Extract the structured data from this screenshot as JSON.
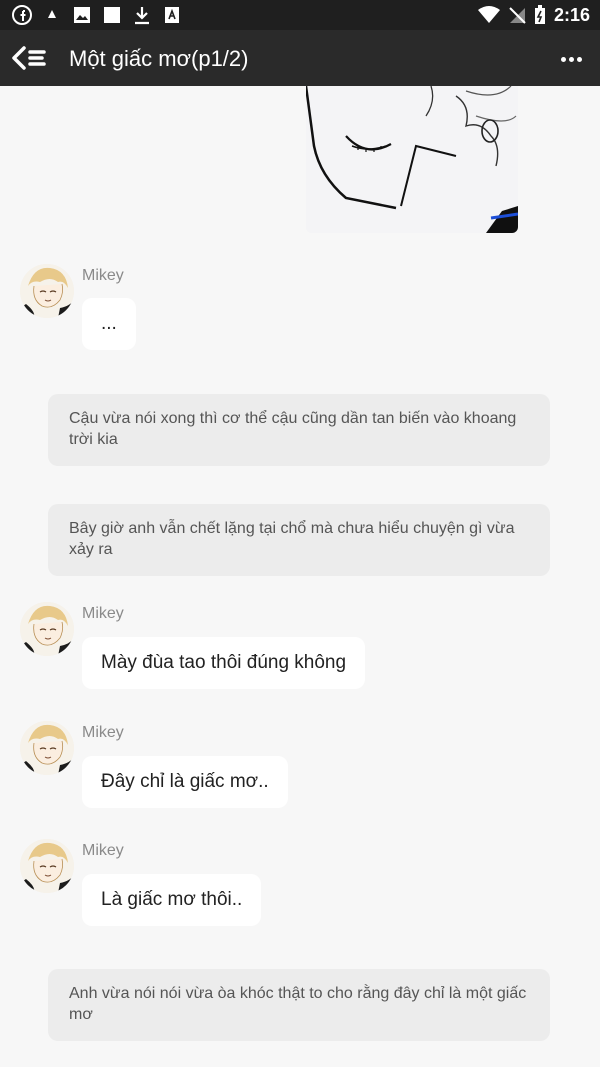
{
  "status_bar": {
    "time": "2:16",
    "left_icons": [
      "facebook-icon",
      "notification-icon",
      "gallery-icon",
      "square-icon",
      "download-icon",
      "app-icon"
    ],
    "right_icons": [
      "wifi-icon",
      "no-signal-icon",
      "battery-icon"
    ]
  },
  "app_bar": {
    "title": "Một giấc mơ(p1/2)"
  },
  "messages": [
    {
      "type": "character",
      "sender": "Mikey",
      "text": "..."
    },
    {
      "type": "narration",
      "text": "Cậu vừa nói xong thì cơ thể cậu cũng dần tan biến vào khoang trời kia"
    },
    {
      "type": "narration",
      "text": "Bây giờ anh vẫn chết lặng tại chổ mà chưa hiểu chuyện gì vừa xảy ra"
    },
    {
      "type": "character",
      "sender": "Mikey",
      "text": "Mày đùa tao thôi đúng không"
    },
    {
      "type": "character",
      "sender": "Mikey",
      "text": "Đây chỉ là giấc mơ.."
    },
    {
      "type": "character",
      "sender": "Mikey",
      "text": "Là giấc mơ thôi.."
    },
    {
      "type": "narration",
      "text": "Anh vừa nói nói vừa òa khóc thật to cho rằng đây chỉ là một giấc mơ"
    }
  ]
}
